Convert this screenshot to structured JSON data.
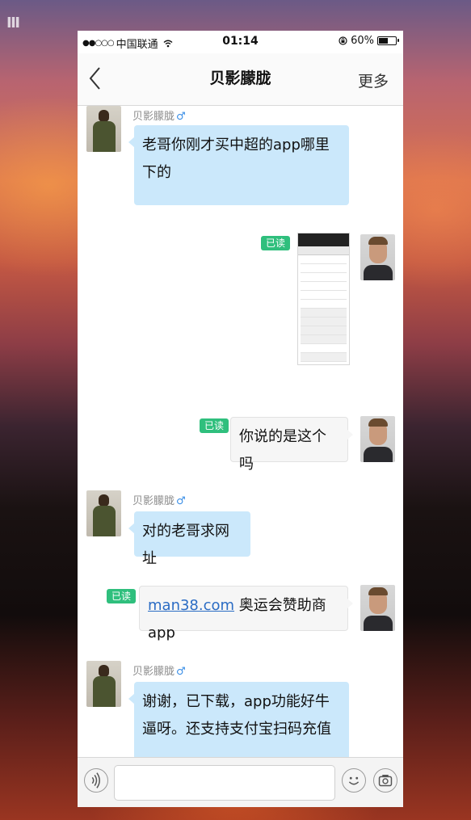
{
  "background": {
    "watermark": "Ⅲ"
  },
  "status_bar": {
    "signal": "●●○○○",
    "carrier": "中国联通",
    "time": "01:14",
    "battery_level": 0.6,
    "battery": "60%"
  },
  "nav": {
    "back_icon": "chevron-left-icon",
    "title": "贝影朦胧",
    "more": "更多"
  },
  "chat": {
    "messages": [
      {
        "side": "left",
        "sender": "贝影朦胧",
        "gender_icon": "♂",
        "text": "老哥你刚才买中超的app哪里下的"
      },
      {
        "side": "right",
        "read": "已读",
        "type": "image"
      },
      {
        "side": "right",
        "read": "已读",
        "text": "你说的是这个吗"
      },
      {
        "side": "left",
        "sender": "贝影朦胧",
        "gender_icon": "♂",
        "text": "对的老哥求网址"
      },
      {
        "side": "right",
        "read": "已读",
        "link": "man38.com",
        "text": " 奥运会赞助商app"
      },
      {
        "side": "left",
        "sender": "贝影朦胧",
        "gender_icon": "♂",
        "text": "谢谢，已下载，app功能好牛逼呀。还支持支付宝扫码充值"
      }
    ]
  },
  "input_bar": {
    "voice_icon": "voice-icon",
    "placeholder": "",
    "emoji_icon": "smiley-icon",
    "camera_icon": "camera-icon"
  },
  "colors": {
    "incoming_bubble": "#cbe8fb",
    "read_badge": "#2fbf7d",
    "link": "#2b6cc4"
  }
}
